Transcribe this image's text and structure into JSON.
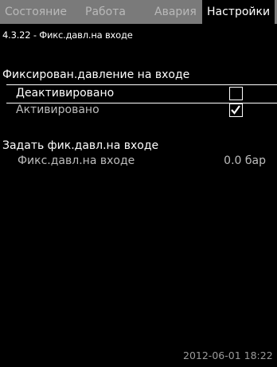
{
  "tabs": [
    {
      "label": "Состояние",
      "active": false
    },
    {
      "label": "Работа",
      "active": false
    },
    {
      "label": "Авария",
      "active": false
    },
    {
      "label": "Настройки",
      "active": true
    }
  ],
  "breadcrumb": "4.3.22 - Фикс.давл.на входе",
  "section1": {
    "title": "Фиксирован.давление на входе",
    "options": [
      {
        "label": "Деактивировано",
        "checked": false,
        "selected": true
      },
      {
        "label": "Активировано",
        "checked": true,
        "selected": false
      }
    ]
  },
  "section2": {
    "title": "Задать фик.давл.на входе",
    "field": {
      "label": "Фикс.давл.на входе",
      "value": "0.0 бар"
    }
  },
  "footer": {
    "datetime": "2012-06-01 18:22"
  },
  "colors": {
    "tabbar": "#7a7a7a",
    "background": "#000000",
    "text": "#ffffff",
    "dim_text": "#bdbdbd"
  },
  "icons": {
    "unchecked": "checkbox-empty-icon",
    "checked": "checkbox-checked-icon"
  }
}
